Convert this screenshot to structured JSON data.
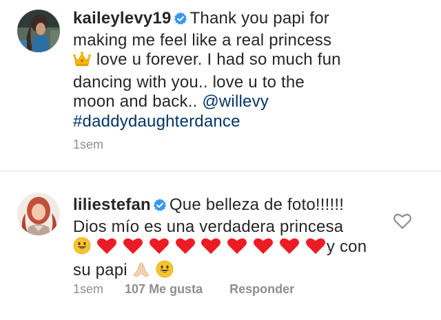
{
  "comments": [
    {
      "username": "kaileylevy19",
      "verified": true,
      "text_parts": {
        "line1_rest": "Thank you papi  for",
        "line2": "making me feel like a real princess",
        "line3_rest": "love u forever. I had so much fun",
        "line4": "dancing with you.. love u to the",
        "line5_text": "moon and back..",
        "mention": "@willevy",
        "hashtag": "#daddydaughterdance"
      },
      "emoji": [
        "crown-icon"
      ],
      "time": "1sem"
    },
    {
      "username": "liliestefan",
      "verified": true,
      "text_parts": {
        "line1_rest": "Que belleza de foto!!!!!!",
        "line2": "Dios mío es una verdadera princesa",
        "line3_rest": "y con",
        "line4_text": "su papi"
      },
      "emoji": [
        "smile-icon",
        "heart-icon",
        "heart-icon",
        "heart-icon",
        "heart-icon",
        "heart-icon",
        "heart-icon",
        "heart-icon",
        "heart-icon",
        "heart-icon",
        "pray-icon",
        "smile-icon"
      ],
      "time": "1sem",
      "likes": "107 Me gusta",
      "reply": "Responder"
    }
  ],
  "colors": {
    "text": "#262626",
    "link": "#003569",
    "meta": "#8e8e8e",
    "verified": "#3897f0",
    "heart": "#ed1c24",
    "divider": "#dbdbdb"
  }
}
